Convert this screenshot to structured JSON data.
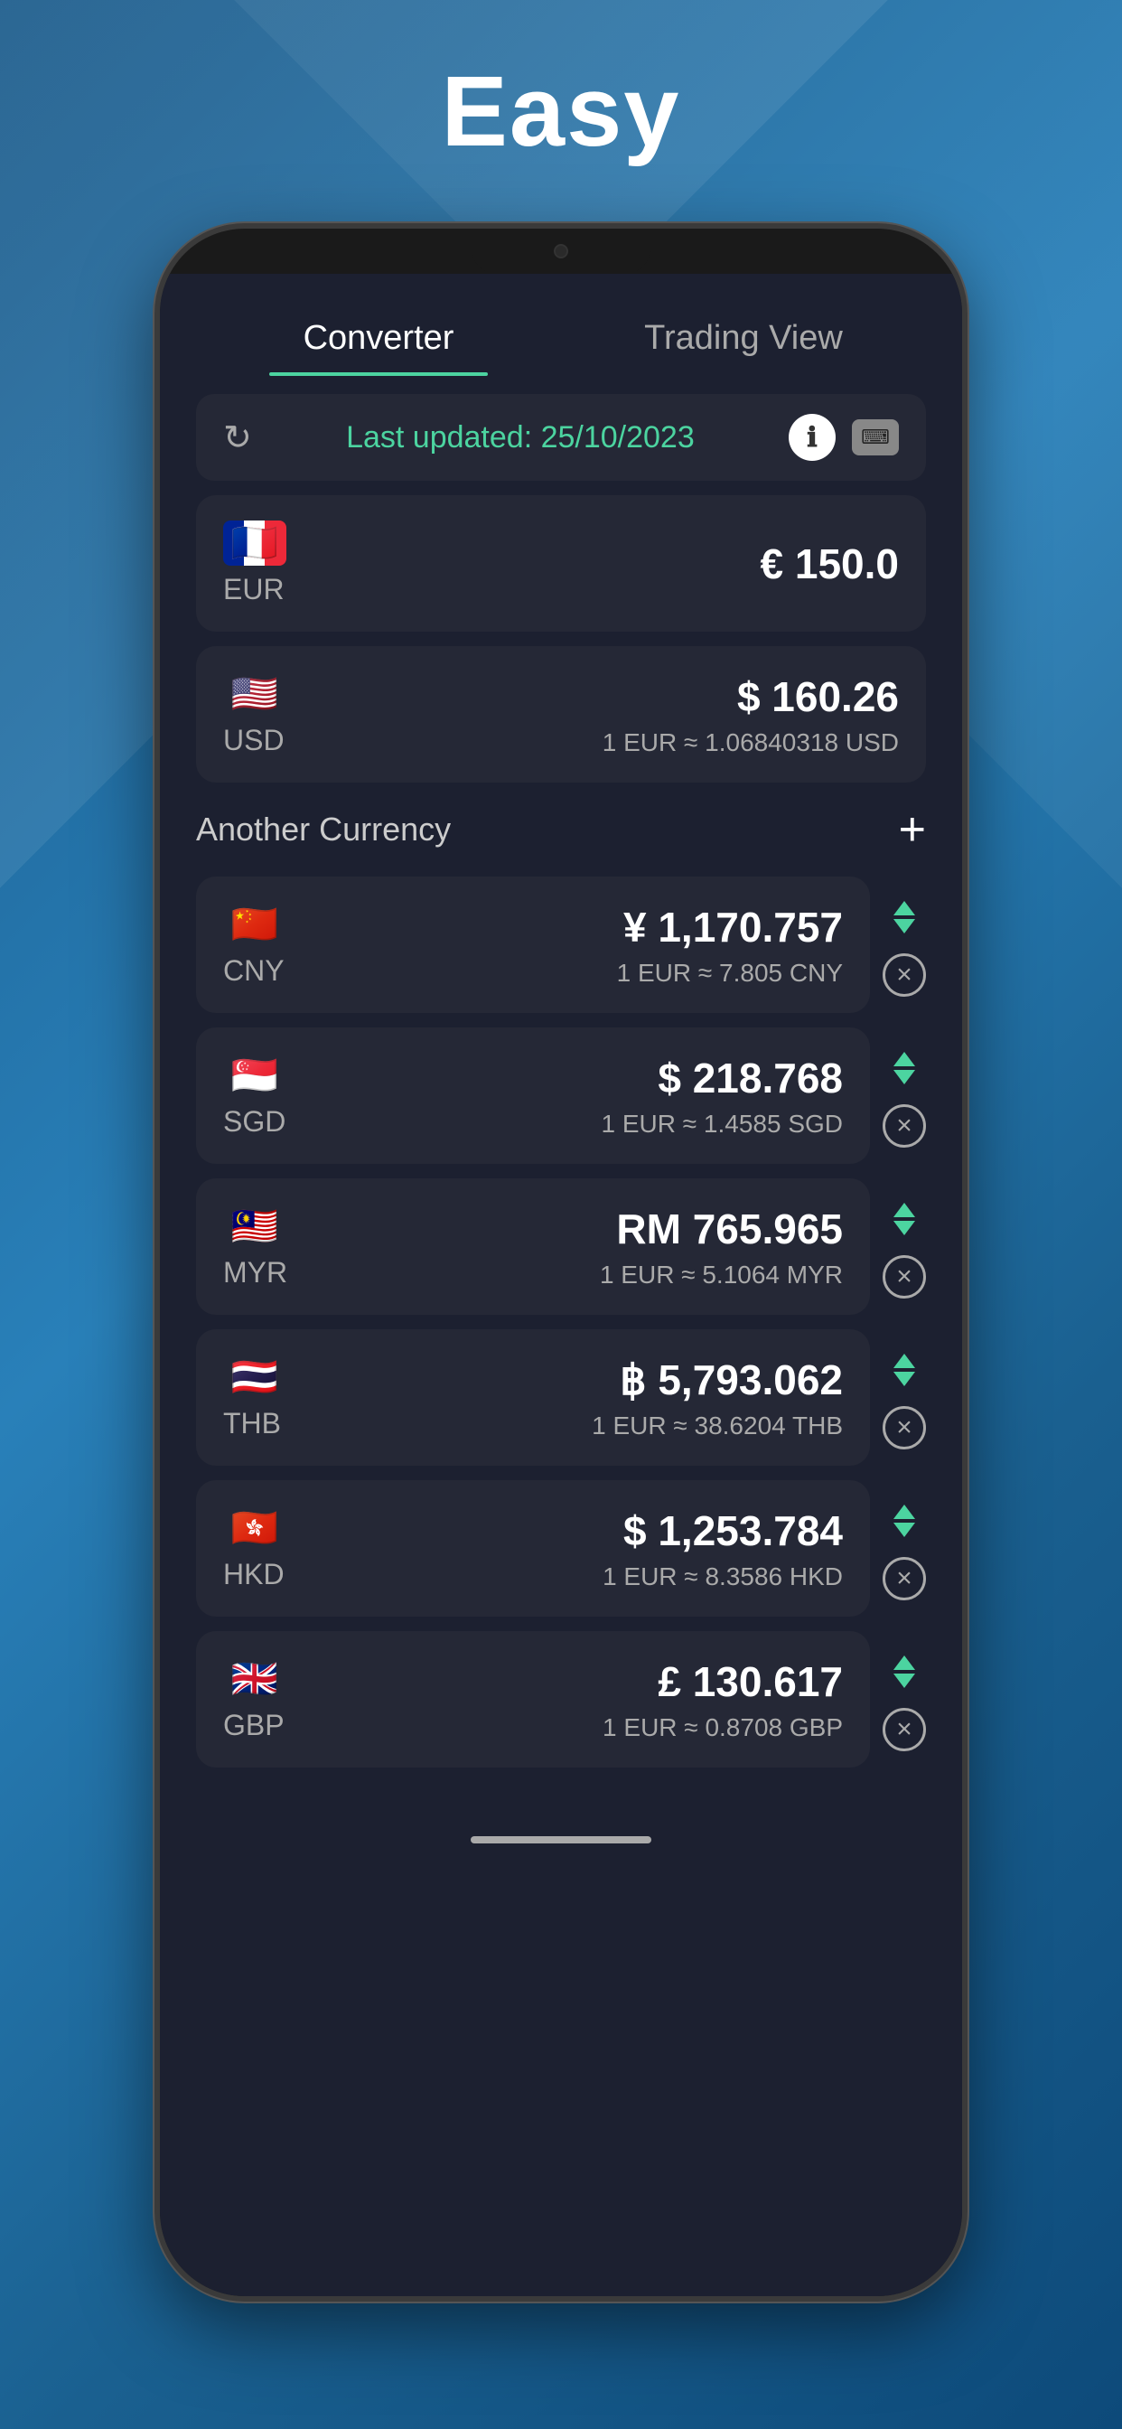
{
  "page": {
    "title": "Easy",
    "background_description": "blue gradient with diagonal shapes"
  },
  "tabs": {
    "converter": {
      "label": "Converter",
      "active": true
    },
    "trading_view": {
      "label": "Trading View",
      "active": false
    }
  },
  "status_bar": {
    "last_updated_label": "Last updated: 25/10/2023",
    "info_icon": "ℹ",
    "keyboard_icon": "⌨"
  },
  "base_currency": {
    "code": "EUR",
    "flag": "🇫🇷",
    "amount": "€ 150.0"
  },
  "usd_currency": {
    "code": "USD",
    "flag": "🇺🇸",
    "amount": "$ 160.26",
    "rate": "1 EUR ≈ 1.06840318 USD"
  },
  "add_currency_label": "Another Currency",
  "add_button_label": "+",
  "currencies": [
    {
      "code": "CNY",
      "flag": "🇨🇳",
      "amount": "¥ 1,170.757",
      "rate": "1 EUR ≈ 7.805 CNY"
    },
    {
      "code": "SGD",
      "flag": "🇸🇬",
      "amount": "$ 218.768",
      "rate": "1 EUR ≈ 1.4585 SGD"
    },
    {
      "code": "MYR",
      "flag": "🇲🇾",
      "amount": "RM 765.965",
      "rate": "1 EUR ≈ 5.1064 MYR"
    },
    {
      "code": "THB",
      "flag": "🇹🇭",
      "amount": "฿ 5,793.062",
      "rate": "1 EUR ≈ 38.6204 THB"
    },
    {
      "code": "HKD",
      "flag": "🇭🇰",
      "amount": "$ 1,253.784",
      "rate": "1 EUR ≈ 8.3586 HKD"
    },
    {
      "code": "GBP",
      "flag": "🇬🇧",
      "amount": "£ 130.617",
      "rate": "1 EUR ≈ 0.8708 GBP"
    }
  ]
}
